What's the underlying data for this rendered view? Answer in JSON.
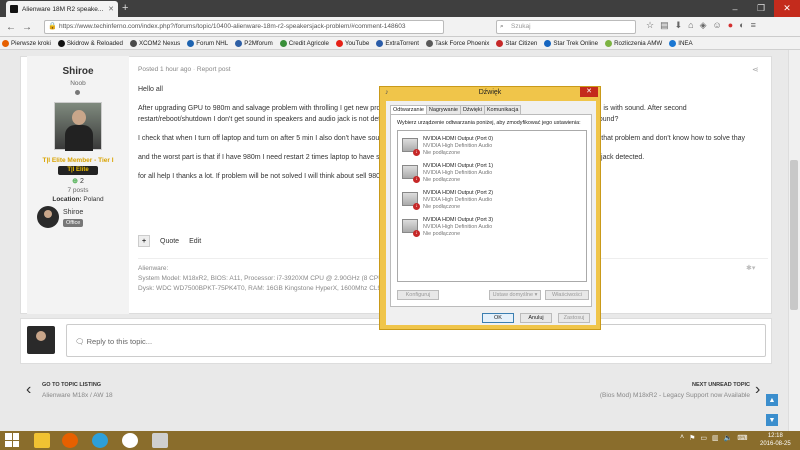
{
  "browser": {
    "tab_title": "Alienware 18M R2 speake...",
    "url": "https://www.techinferno.com/index.php?/forums/topic/10400-alienware-18m-r2-speakersjack-problem/#comment-148603",
    "search_placeholder": "Szukaj",
    "bookmarks": [
      "Pierwsze kroki",
      "Skidrow & Reloaded",
      "XCOM2 Nexus",
      "Forum NHL",
      "P2Mforum",
      "Credit Agricole",
      "YouTube",
      "ExtraTorrent",
      "Task Force Phoenix",
      "Star Citizen",
      "Star Trek Online",
      "Rozliczenia AMW",
      "INEA"
    ],
    "bookmark_colors": [
      "#e66000",
      "#111111",
      "#4a4a4a",
      "#1d63b0",
      "#2e5fa5",
      "#3a8f3a",
      "#e62117",
      "#2a5ca8",
      "#5a5a5a",
      "#c62828",
      "#1565c0",
      "#7cb342",
      "#1976d2"
    ]
  },
  "author": {
    "name": "Shiroe",
    "rank": "Noob",
    "member_title": "T|I Elite Member - Tier I",
    "badge": "T|I Elite",
    "reputation": "2",
    "posts": "7 posts",
    "location_label": "Location:",
    "location_value": "Poland",
    "mini_name": "Shiroe",
    "mini_badge": "Office"
  },
  "post": {
    "posted": "Posted 1 hour ago",
    "separator": "·",
    "report": "Report post",
    "paragraphs": [
      "Hello all",
      "After upgrading GPU to 980m and salvage problem with throlling I get new problem, i dont know if it is connected with upgrade or not but that problem is with sound. After second restart/reboot/shutdown I don't get sound in speakers and audio jack is not detected. My question is is there same way to salvage that problem with sound?",
      "I check that when I turn off laptop and turn on after 5 min I also don't have sound in speakers. I also install new drivers but nothing. I don't understand that problem and don't know how to solve thay",
      "and the worst part is that if I have 980m I need restart 2 times laptop to have sound in speakers and HDMI only and after that I have sound and audio jack detected.",
      "for all help I thanks a lot. If problem will be not solved I will think about sell 980m and buy 880m or I find another card."
    ],
    "multiquote": "+",
    "quote": "Quote",
    "edit": "Edit",
    "signature_title": "Alienware:",
    "signature_line1": "System Model: M18xR2, BIOS: A11, Processor: i7-3920XM CPU @ 2.90GHz (8 CPUs), GPU: GTX 980M 8GB",
    "signature_line2": "Dysk: WDC WD7500BPKT-75PK4T0, RAM: 16GB Kingstone HyperX, 1600Mhz CL9"
  },
  "reply": {
    "placeholder": "Reply to this topic..."
  },
  "navigation": {
    "prev_label": "GO TO TOPIC LISTING",
    "prev_title": "Alienware M18x / AW 18",
    "next_label": "NEXT UNREAD TOPIC",
    "next_title": "(Bios Mod) M18xR2 - Legacy Support now Available"
  },
  "dialog": {
    "title": "Dźwięk",
    "tabs": [
      "Odtwarzanie",
      "Nagrywanie",
      "Dźwięki",
      "Komunikacja"
    ],
    "instruction": "Wybierz urządzenie odtwarzania poniżej, aby zmodyfikować jego ustawienia:",
    "devices": [
      {
        "name": "NVIDIA HDMI Output (Port 0)",
        "driver": "NVIDIA High Definition Audio",
        "status": "Nie podłączone"
      },
      {
        "name": "NVIDIA HDMI Output (Port 1)",
        "driver": "NVIDIA High Definition Audio",
        "status": "Nie podłączone"
      },
      {
        "name": "NVIDIA HDMI Output (Port 2)",
        "driver": "NVIDIA High Definition Audio",
        "status": "Nie podłączone"
      },
      {
        "name": "NVIDIA HDMI Output (Port 3)",
        "driver": "NVIDIA High Definition Audio",
        "status": "Nie podłączone"
      }
    ],
    "configure": "Konfiguruj",
    "set_default": "Ustaw domyślne",
    "properties": "Właściwości",
    "ok": "OK",
    "cancel": "Anuluj",
    "apply": "Zastosuj"
  },
  "taskbar": {
    "time": "12:18",
    "date": "2016-08-25"
  }
}
